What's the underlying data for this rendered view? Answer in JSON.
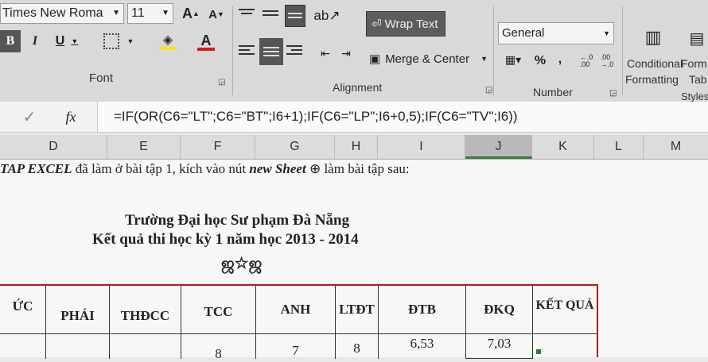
{
  "ribbon": {
    "font": {
      "name": "Times New Roma",
      "size": "11",
      "grow_label": "A",
      "shrink_label": "A",
      "bold_label": "B",
      "italic_label": "I",
      "underline_label": "U",
      "group_label": "Font"
    },
    "alignment": {
      "wrap_text_label": "Wrap Text",
      "merge_center_label": "Merge & Center",
      "group_label": "Alignment"
    },
    "number": {
      "format": "General",
      "percent_label": "%",
      "comma_label": ",",
      "group_label": "Number"
    },
    "styles": {
      "conditional_line1": "Conditional",
      "conditional_line2": "Formatting",
      "format_as_table_line1": "Form",
      "format_as_table_line2": "Tab",
      "group_label": "Styles"
    }
  },
  "formula_bar": {
    "fx_label": "fx",
    "formula": "=IF(OR(C6=\"LT\";C6=\"BT\";I6+1);IF(C6=\"LP\";I6+0,5);IF(C6=\"TV\";I6))"
  },
  "columns": [
    "D",
    "E",
    "F",
    "G",
    "H",
    "I",
    "J",
    "K",
    "L",
    "M"
  ],
  "sheet": {
    "instruction_bold": "TAP EXCEL",
    "instruction_middle": " đã làm ở bài tập 1, kích vào nút ",
    "instruction_italic": "new Sheet",
    "instruction_end": " ⊕ làm bài tập sau:",
    "school": "Trường Đại học Sư phạm Đà Nẵng",
    "exam_title": "Kết quả thi học kỳ 1 năm học 2013 - 2014",
    "ornament": "ஜ☆ஜ",
    "headers": [
      "ỨC",
      "PHÁI",
      "THĐCC",
      "TCC",
      "ANH",
      "LTĐT",
      "ĐTB",
      "ĐKQ",
      "KẾT QUẢ"
    ],
    "row1": [
      "",
      "",
      "",
      "8",
      "7",
      "8",
      "6,53",
      "7,03",
      ""
    ]
  },
  "colors": {
    "table_border": "#b01c1c",
    "ribbon_bg": "#d9d9d9"
  }
}
